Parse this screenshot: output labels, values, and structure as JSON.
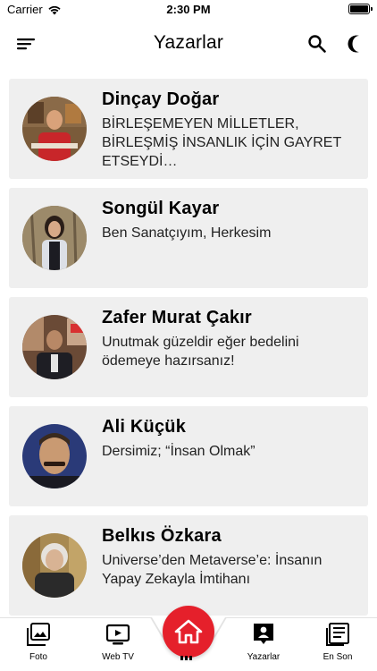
{
  "status": {
    "carrier": "Carrier",
    "time": "2:30 PM"
  },
  "nav": {
    "title": "Yazarlar"
  },
  "authors": [
    {
      "name": "Dinçay Doğar",
      "subtitle": "BİRLEŞEMEYEN MİLLETLER, BİRLEŞMİŞ İNSANLIK İÇİN GAYRET ETSEYDİ…"
    },
    {
      "name": "Songül Kayar",
      "subtitle": "Ben Sanatçıyım, Herkesim"
    },
    {
      "name": "Zafer Murat Çakır",
      "subtitle": "Unutmak güzeldir eğer bedelini ödemeye hazırsanız!"
    },
    {
      "name": "Ali Küçük",
      "subtitle": "Dersimiz; “İnsan Olmak”"
    },
    {
      "name": "Belkıs Özkara",
      "subtitle": "Universe’den Metaverse’e: İnsanın Yapay Zekayla İmtihanı"
    }
  ],
  "tabs": {
    "foto": "Foto",
    "webtv": "Web TV",
    "yazarlar": "Yazarlar",
    "enson": "En Son"
  },
  "colors": {
    "accent": "#e5202b",
    "card_bg": "#efefef"
  },
  "icons": [
    "menu-icon",
    "search-icon",
    "moon-icon",
    "photo-icon",
    "tv-icon",
    "home-icon",
    "author-icon",
    "news-icon"
  ]
}
